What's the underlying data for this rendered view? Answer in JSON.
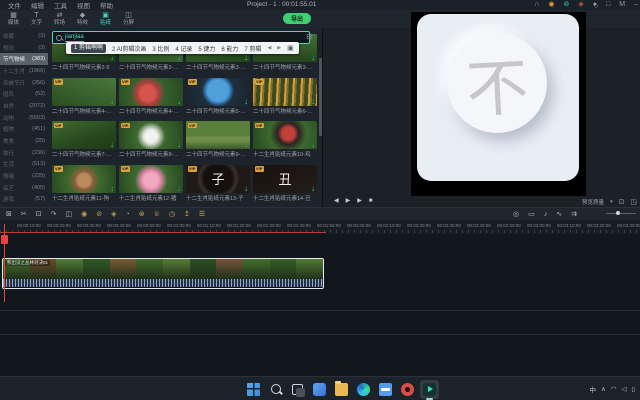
{
  "titlebar": {
    "menus": [
      "文件",
      "编辑",
      "工具",
      "视图",
      "帮助"
    ],
    "title": "Project - 1 : 00:01:55.01",
    "window_icons": [
      {
        "name": "notification-icon",
        "glyph": "∩",
        "color": "#8f99a3"
      },
      {
        "name": "bulb-icon",
        "glyph": "◉",
        "color": "#e0a33c"
      },
      {
        "name": "sync-icon",
        "glyph": "⊚",
        "color": "#3fc9b4"
      },
      {
        "name": "cart-icon",
        "glyph": "◈",
        "color": "#c0604a"
      },
      {
        "name": "account-icon",
        "glyph": "●",
        "color": "#8f99a3"
      },
      {
        "name": "layout-icon",
        "glyph": "□",
        "color": "#8f99a3"
      },
      {
        "name": "maximize-icon",
        "glyph": "M",
        "color": "#8f99a3"
      },
      {
        "name": "minimize-icon",
        "glyph": "–",
        "color": "#8f99a3"
      }
    ]
  },
  "toolbar": {
    "tabs": [
      {
        "label": "媒体",
        "glyph": "▦",
        "active": false
      },
      {
        "label": "文字",
        "glyph": "T",
        "active": false
      },
      {
        "label": "转场",
        "glyph": "⇄",
        "active": false
      },
      {
        "label": "特效",
        "glyph": "◆",
        "active": false
      },
      {
        "label": "贴纸",
        "glyph": "▣",
        "active": true
      },
      {
        "label": "分屏",
        "glyph": "◫",
        "active": false
      }
    ],
    "export_label": "导出"
  },
  "library": {
    "categories": [
      {
        "name": "收藏",
        "count": "(3)",
        "selected": false
      },
      {
        "name": "预设",
        "count": "(3)",
        "selected": false
      },
      {
        "name": "节气物候",
        "count": "(383)",
        "selected": true
      },
      {
        "name": "十二生肖",
        "count": "(1966)",
        "selected": false
      },
      {
        "name": "传统节日",
        "count": "(256)",
        "selected": false
      },
      {
        "name": "国风",
        "count": "(52)",
        "selected": false
      },
      {
        "name": "自然",
        "count": "(2072)",
        "selected": false
      },
      {
        "name": "动物",
        "count": "(5503)",
        "selected": false
      },
      {
        "name": "植物",
        "count": "(451)",
        "selected": false
      },
      {
        "name": "美食",
        "count": "(25)",
        "selected": false
      },
      {
        "name": "旅行",
        "count": "(236)",
        "selected": false
      },
      {
        "name": "生活",
        "count": "(513)",
        "selected": false
      },
      {
        "name": "情绪",
        "count": "(225)",
        "selected": false
      },
      {
        "name": "综艺",
        "count": "(405)",
        "selected": false
      },
      {
        "name": "游戏",
        "count": "(57)",
        "selected": false
      }
    ],
    "search": {
      "composition": "jianjiaa",
      "grid_icon": "⊞"
    },
    "ime": {
      "candidates": [
        "剪辑啊啊",
        "AI剪辑次画",
        "比例",
        "记录",
        "键力",
        "能力",
        "剪辑"
      ],
      "prev": "◀",
      "next": "▶",
      "more_icon": "▣"
    },
    "vip_label": "VIP",
    "download_glyph": "↓",
    "items": [
      {
        "title": "二十四节气物候元素2-9",
        "visual": "garden1",
        "glyph": ""
      },
      {
        "title": "二十四节气物候元素2-…",
        "visual": "garden2",
        "glyph": ""
      },
      {
        "title": "二十四节气物候元素3-…",
        "visual": "garden3",
        "glyph": ""
      },
      {
        "title": "二十四节气物候元素3-…",
        "visual": "garden4",
        "glyph": ""
      },
      {
        "title": "二十四节气物候元素4-…",
        "visual": "garden2",
        "glyph": ""
      },
      {
        "title": "二十四节气物候元素4-…",
        "visual": "flowersred",
        "glyph": ""
      },
      {
        "title": "二十四节气物候元素5-…",
        "visual": "earth",
        "glyph": ""
      },
      {
        "title": "二十四节气物候元素6-…",
        "visual": "wheat",
        "glyph": ""
      },
      {
        "title": "二十四节气物候元素7-…",
        "visual": "garden1",
        "glyph": ""
      },
      {
        "title": "二十四节气物候元素8-…",
        "visual": "flowerwhite",
        "glyph": ""
      },
      {
        "title": "二十四节气物候元素9-…",
        "visual": "field",
        "glyph": ""
      },
      {
        "title": "十二生肖贴纸元素10-鸡",
        "visual": "rooster",
        "glyph": ""
      },
      {
        "title": "十二生肖贴纸元素11-狗",
        "visual": "dog",
        "glyph": ""
      },
      {
        "title": "十二生肖贴纸元素12-猪",
        "visual": "pig",
        "glyph": ""
      },
      {
        "title": "十二生肖贴纸元素13-子",
        "visual": "zi",
        "glyph": "子"
      },
      {
        "title": "十二生肖贴纸元素14-丑",
        "visual": "chou",
        "glyph": "丑"
      }
    ]
  },
  "preview": {
    "glyph": "不",
    "controls": [
      {
        "name": "previous-frame-button",
        "glyph": "◀"
      },
      {
        "name": "play-button",
        "glyph": "▶"
      },
      {
        "name": "next-frame-button",
        "glyph": "▶"
      },
      {
        "name": "stop-button",
        "glyph": "■"
      }
    ],
    "quality_label": "预览质量",
    "quality_caret": "▾",
    "snapshot_icon": "⊡",
    "fullscreen_icon": "◳"
  },
  "timeline": {
    "left_tools": [
      {
        "name": "delete-icon",
        "glyph": "⊠",
        "gold": false
      },
      {
        "name": "split-icon",
        "glyph": "✂",
        "gold": false
      },
      {
        "name": "crop-icon",
        "glyph": "⊡",
        "gold": false
      },
      {
        "name": "speed-icon",
        "glyph": "↷",
        "gold": false
      },
      {
        "name": "mirror-icon",
        "glyph": "◫",
        "gold": false
      },
      {
        "name": "keyframe-icon",
        "glyph": "◉",
        "gold": true
      },
      {
        "name": "mask-icon",
        "glyph": "⊘",
        "gold": true
      },
      {
        "name": "chroma-key-icon",
        "glyph": "◈",
        "gold": true
      },
      {
        "name": "motion-track-icon",
        "glyph": "◔",
        "gold": true
      },
      {
        "name": "denoise-icon",
        "glyph": "⊗",
        "gold": true
      },
      {
        "name": "premium-crown-icon",
        "glyph": "♕",
        "gold": true
      },
      {
        "name": "duration-icon",
        "glyph": "◷",
        "gold": true
      },
      {
        "name": "upload-icon",
        "glyph": "↥",
        "gold": true
      },
      {
        "name": "adjust-icon",
        "glyph": "☰",
        "gold": true
      }
    ],
    "right_tools": [
      {
        "name": "record-icon",
        "glyph": "◎"
      },
      {
        "name": "marker-icon",
        "glyph": "▭"
      },
      {
        "name": "voiceover-mic-icon",
        "glyph": "♪"
      },
      {
        "name": "audio-wave-icon",
        "glyph": "∿"
      },
      {
        "name": "snap-icon",
        "glyph": "⇉"
      }
    ],
    "zoom_icon": "○",
    "ruler_labels": [
      "00:00:10:00",
      "00:00:20:00",
      "00:00:30:00",
      "00:00:40:00",
      "00:00:50:00",
      "00:01:00:00",
      "00:01:10:00",
      "00:01:20:00",
      "00:01:30:00",
      "00:01:40:00",
      "00:01:50:00",
      "00:02:00:00",
      "00:02:10:00",
      "00:02:20:00",
      "00:02:30:00",
      "00:02:40:00",
      "00:02:50:00",
      "00:03:00:00",
      "00:03:10:00",
      "00:03:20:00",
      "00:03:30:00"
    ],
    "clip": {
      "label": "熊出没之丛林对决01",
      "frames": [
        "#47702e",
        "#6b4a2e",
        "#517c36",
        "#2e5a27",
        "#7a5a33",
        "#3f6b2e",
        "#587c35",
        "#2e4f26",
        "#75523a",
        "#44702c",
        "#365f28",
        "#507a33"
      ]
    }
  },
  "taskbar": {
    "icons": [
      {
        "name": "start-button",
        "type": "start",
        "active": false
      },
      {
        "name": "search-button",
        "type": "search",
        "active": false
      },
      {
        "name": "task-view-button",
        "type": "taskview",
        "active": false
      },
      {
        "name": "widgets-button",
        "type": "widgets",
        "active": false
      },
      {
        "name": "file-explorer-button",
        "type": "explorer",
        "active": false
      },
      {
        "name": "edge-button",
        "type": "edge",
        "active": false
      },
      {
        "name": "store-button",
        "type": "store",
        "active": false
      },
      {
        "name": "app-red-button",
        "type": "appred",
        "active": false
      },
      {
        "name": "video-editor-button",
        "type": "editor",
        "active": true
      }
    ],
    "tray": [
      {
        "name": "ime-indicator",
        "text": "中"
      },
      {
        "name": "tray-chevron-icon",
        "text": "∧"
      },
      {
        "name": "network-icon",
        "text": "◠"
      },
      {
        "name": "volume-icon",
        "text": "◁"
      },
      {
        "name": "battery-icon",
        "text": "▯"
      }
    ]
  }
}
